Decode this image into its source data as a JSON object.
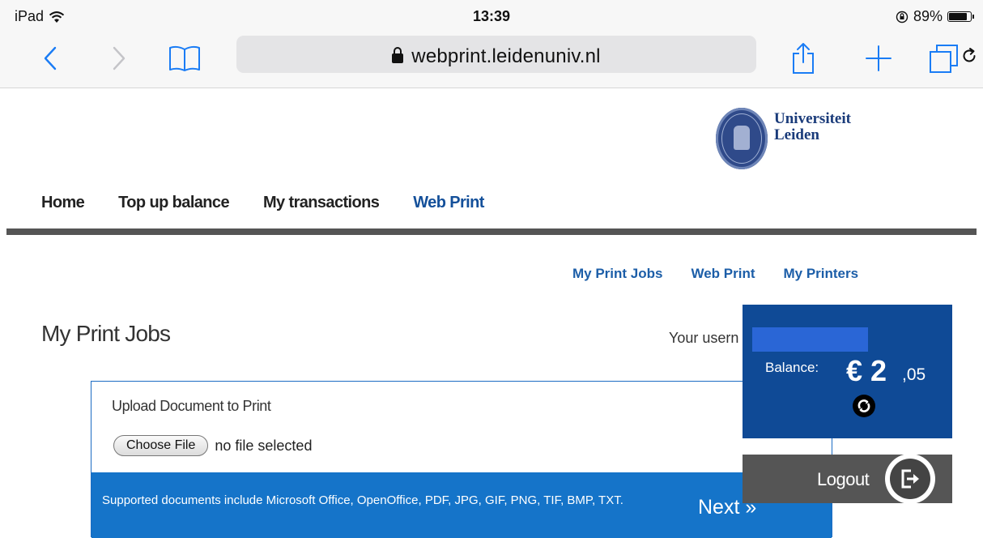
{
  "status_bar": {
    "device": "iPad",
    "time": "13:39",
    "battery": "89%"
  },
  "browser": {
    "url": "webprint.leidenuniv.nl"
  },
  "logo": {
    "line1": "Universiteit",
    "line2": "Leiden"
  },
  "main_nav": [
    {
      "label": "Home",
      "active": false
    },
    {
      "label": "Top up balance",
      "active": false
    },
    {
      "label": "My transactions",
      "active": false
    },
    {
      "label": "Web Print",
      "active": true
    }
  ],
  "sub_nav": [
    "My Print Jobs",
    "Web Print",
    "My Printers"
  ],
  "page": {
    "title": "My Print Jobs",
    "username_label": "Your usern"
  },
  "upload": {
    "title": "Upload Document to Print",
    "choose_button": "Choose File",
    "file_status": "no file selected",
    "supported": "Supported documents include Microsoft Office, OpenOffice, PDF, JPG, GIF, PNG, TIF, BMP, TXT.",
    "next": "Next »"
  },
  "balance": {
    "label": "Balance:",
    "amount": "€ 2",
    "cents": ",05"
  },
  "logout": {
    "label": "Logout"
  }
}
